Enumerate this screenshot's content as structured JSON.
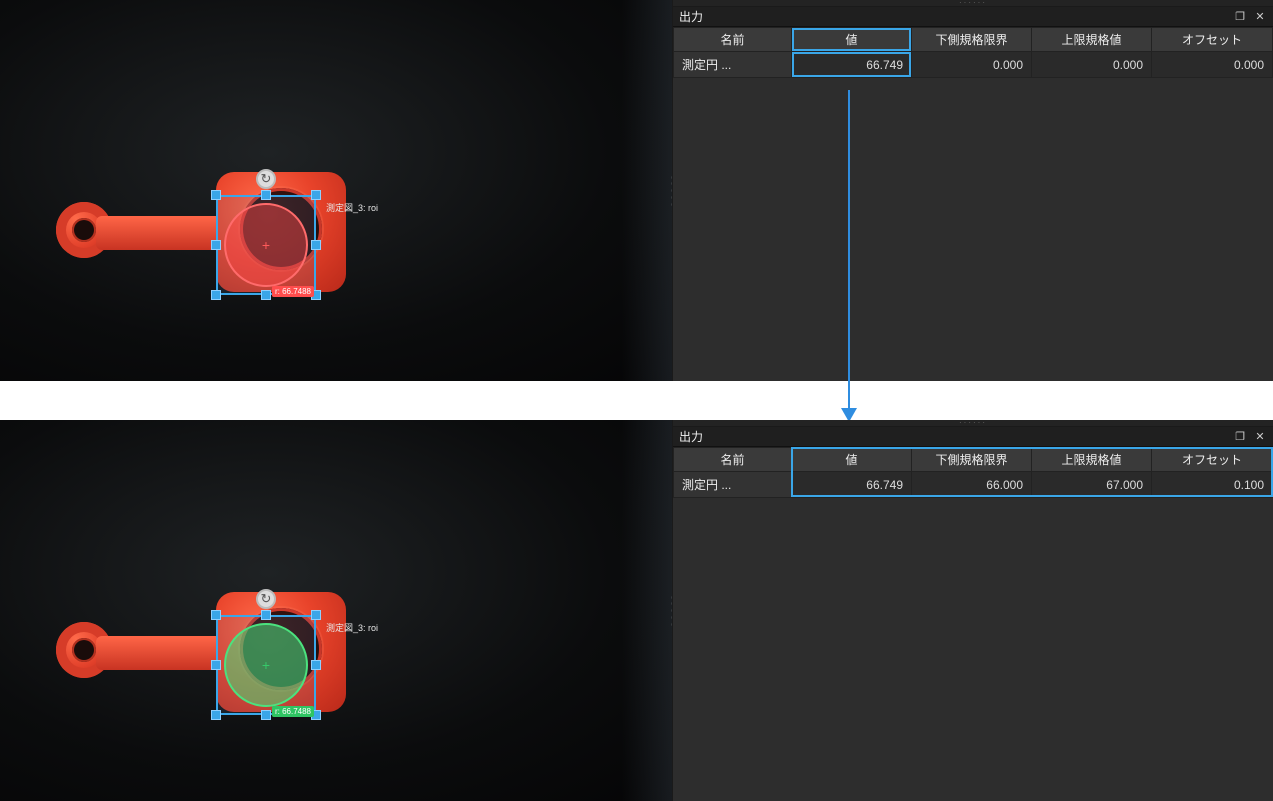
{
  "panel": {
    "title": "出力",
    "top_dots": "······",
    "columns": {
      "name": "名前",
      "value": "値",
      "lower": "下側規格限界",
      "upper": "上限規格値",
      "offset": "オフセット"
    }
  },
  "viewport": {
    "roi_label": "測定図_3: roi",
    "roi_badge_top": "r: 66.7488",
    "roi_badge_bottom": "r: 66.7488"
  },
  "top": {
    "row": {
      "name": "測定円 ...",
      "value": "66.749",
      "lower": "0.000",
      "upper": "0.000",
      "offset": "0.000"
    }
  },
  "bottom": {
    "row": {
      "name": "測定円 ...",
      "value": "66.749",
      "lower": "66.000",
      "upper": "67.000",
      "offset": "0.100"
    }
  },
  "icons": {
    "rotate": "↻",
    "cross": "+",
    "dock": "❐",
    "close": "✕"
  }
}
